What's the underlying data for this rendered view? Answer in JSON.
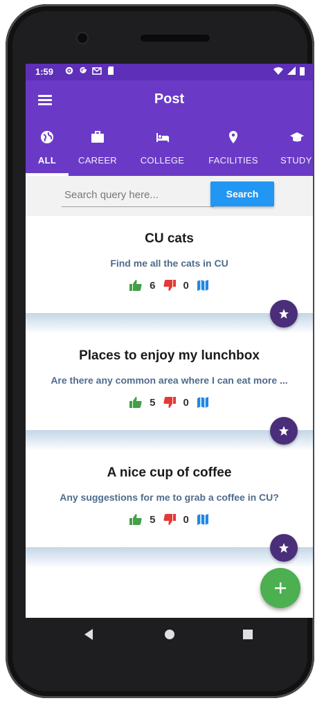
{
  "status_bar": {
    "time": "1:59"
  },
  "app_bar": {
    "title": "Post"
  },
  "tabs": [
    {
      "label": "ALL",
      "icon": "globe-icon",
      "active": true
    },
    {
      "label": "CAREER",
      "icon": "briefcase-icon"
    },
    {
      "label": "COLLEGE",
      "icon": "bed-icon"
    },
    {
      "label": "FACILITIES",
      "icon": "location-pin-icon"
    },
    {
      "label": "STUDY",
      "icon": "graduation-cap-icon"
    }
  ],
  "search": {
    "placeholder": "Search query here...",
    "value": "",
    "button_label": "Search"
  },
  "posts": [
    {
      "title": "CU cats",
      "description": "Find me all the cats in CU",
      "likes": "6",
      "dislikes": "0"
    },
    {
      "title": "Places to enjoy my lunchbox",
      "description": "Are there any common area where I can eat more ...",
      "likes": "5",
      "dislikes": "0"
    },
    {
      "title": "A nice cup of coffee",
      "description": "Any suggestions for me to grab a coffee in CU?",
      "likes": "5",
      "dislikes": "0"
    }
  ],
  "colors": {
    "app_bar": "#6a3ac7",
    "status_bar": "#5e2fb8",
    "search_button": "#2196f3",
    "like": "#43a047",
    "dislike": "#e53935",
    "map": "#1e88e5",
    "favorite_button": "#4a2e7a",
    "fab": "#4caf50"
  }
}
